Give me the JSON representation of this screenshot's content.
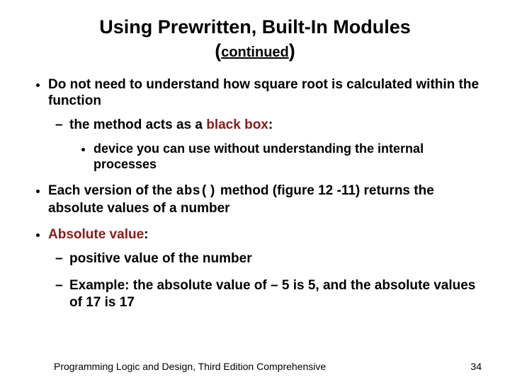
{
  "title": {
    "line1": "Using Prewritten, Built-In Modules",
    "paren_open": "(",
    "sub": "continued",
    "paren_close": ")"
  },
  "bullets": {
    "b1": "Do not need to understand how square root is calculated within the function",
    "b1_s1_pre": "the method acts as a ",
    "b1_s1_kw": "black box",
    "b1_s1_post": ":",
    "b1_s1_d1": "device you can use without understanding the internal processes",
    "b2_pre": "Each version of the ",
    "b2_code": "abs()",
    "b2_post": " method (figure 12 -11) returns the absolute values of a number",
    "b3_kw": "Absolute value",
    "b3_post": ":",
    "b3_s1": "positive value of the number",
    "b3_s2": "Example: the absolute value of – 5 is 5, and the absolute values of 17 is 17"
  },
  "footer": {
    "text": "Programming Logic and Design, Third Edition Comprehensive",
    "page": "34"
  }
}
